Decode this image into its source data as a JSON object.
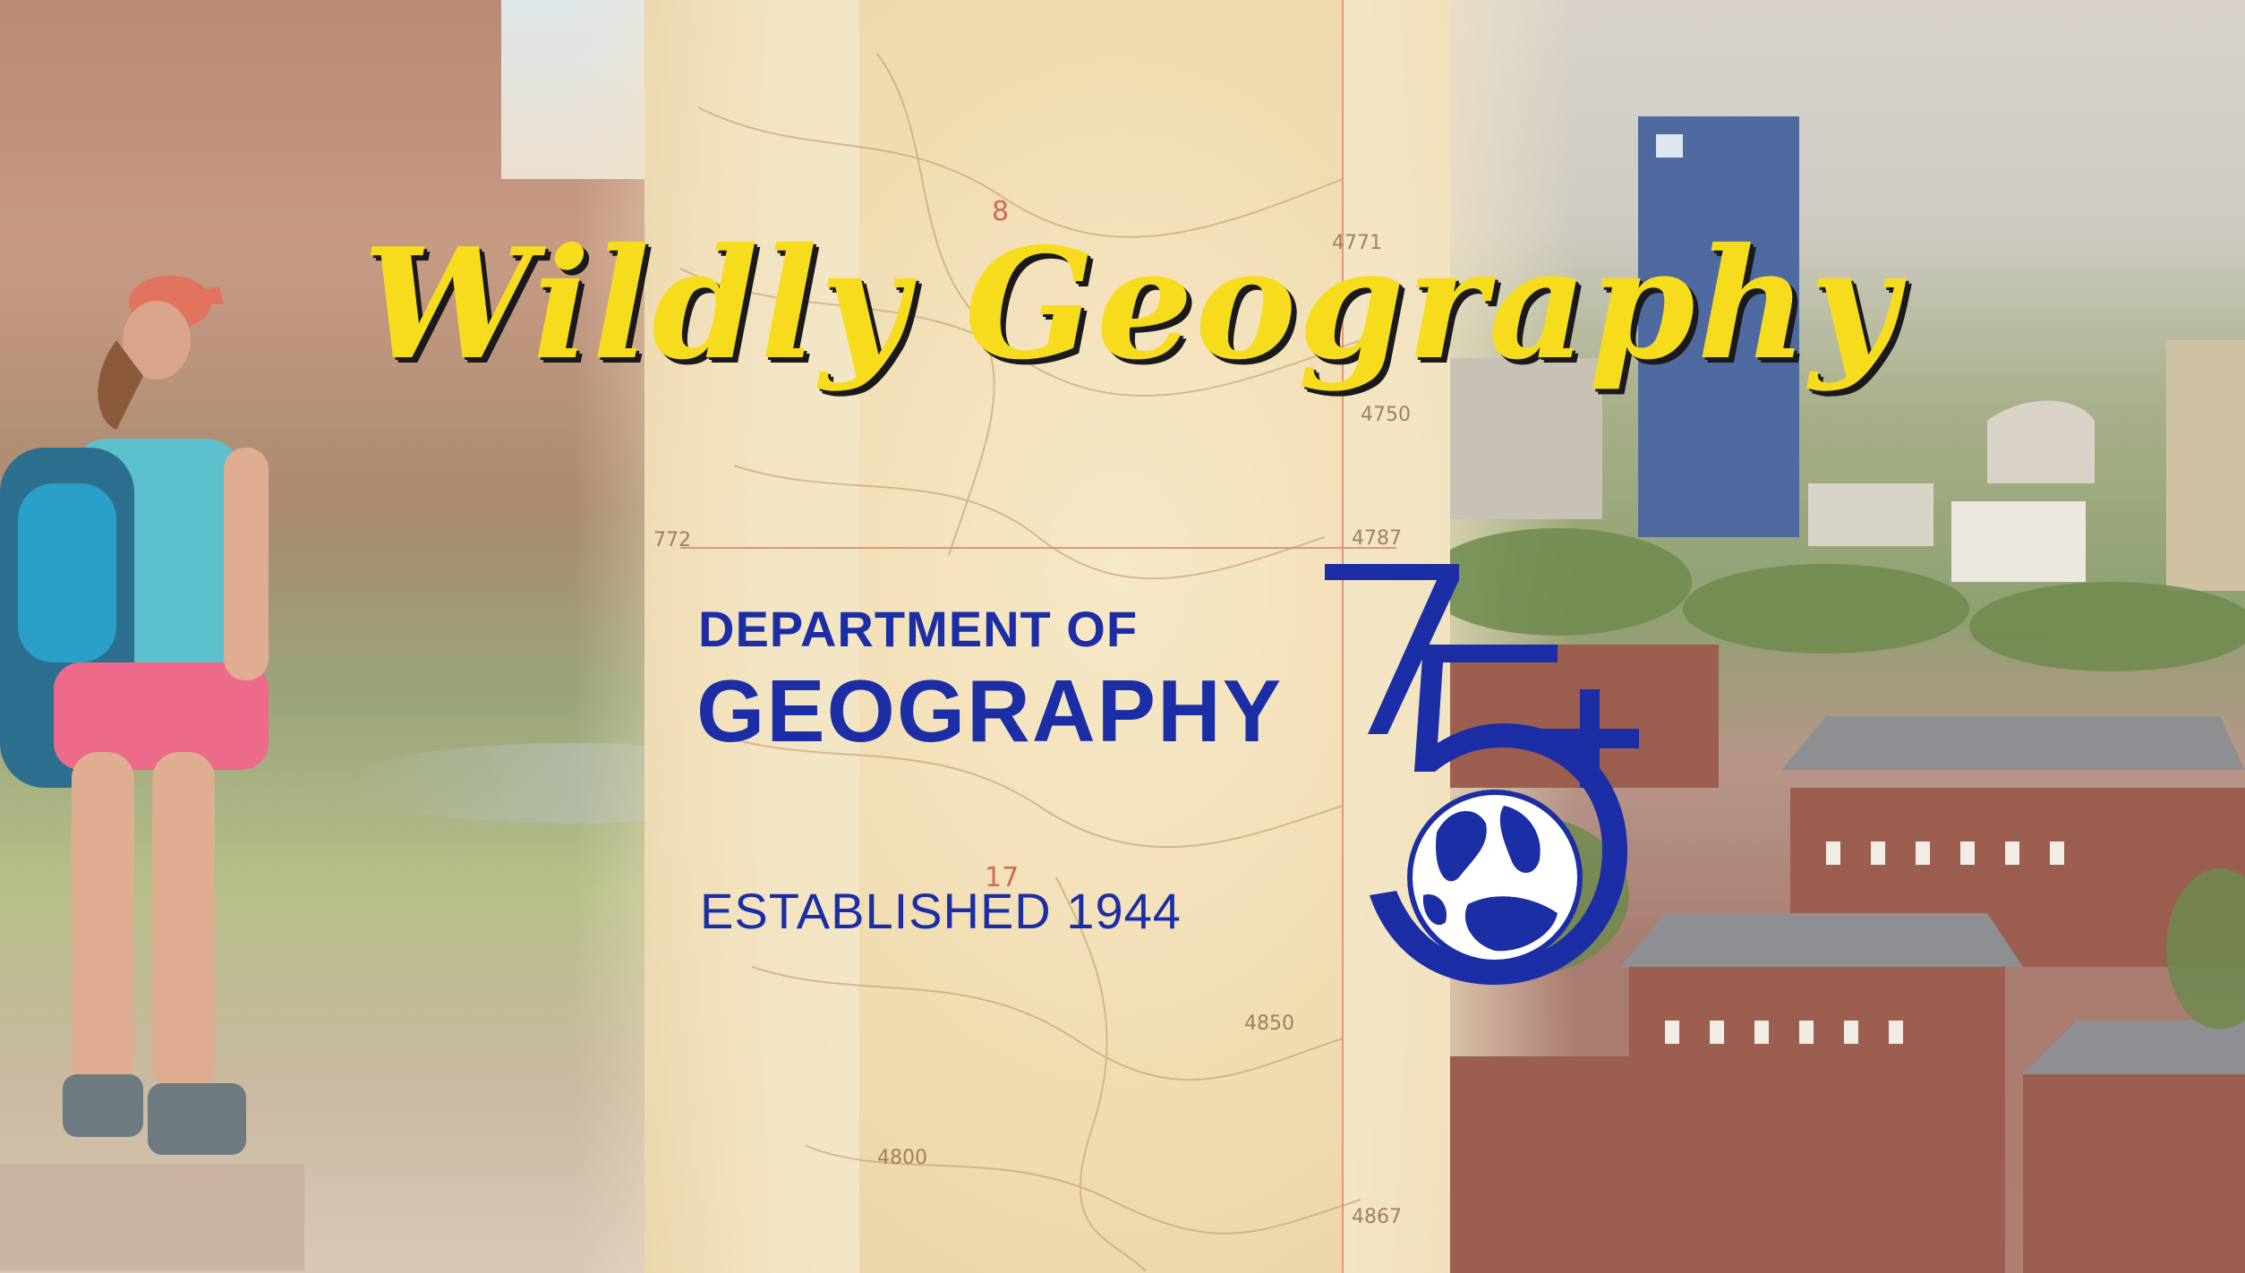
{
  "headline": {
    "text": "Wildly Geography"
  },
  "department": {
    "line1": "DEPARTMENT OF",
    "line2": "GEOGRAPHY",
    "established": "ESTABLISHED 1944",
    "anniversary_mark": "75+",
    "brand_color": "#1c2ea6"
  },
  "map_labels": [
    "8",
    "4771",
    "4750",
    "4787",
    "772",
    "17",
    "4850",
    "4800",
    "4867"
  ],
  "colors": {
    "headline_fill": "#f7dc1d",
    "headline_shadow": "#1a1a1a"
  }
}
